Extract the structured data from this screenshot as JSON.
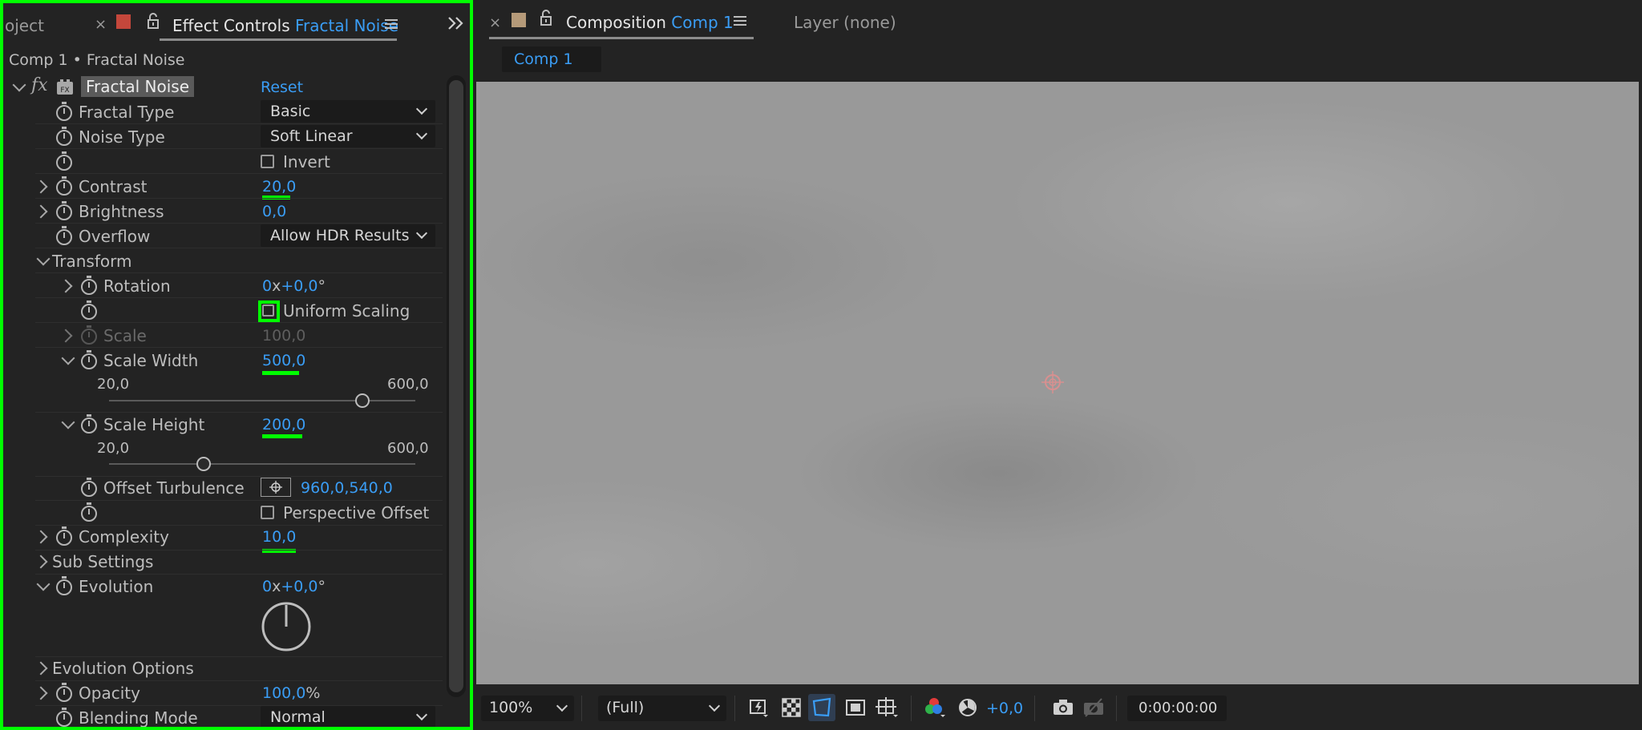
{
  "left_panel": {
    "tabs": {
      "project_partial": "oject",
      "effect_controls_label": "Effect Controls",
      "effect_controls_layer": "Fractal Noise"
    },
    "breadcrumb": "Comp 1 • Fractal Noise",
    "effect": {
      "name": "Fractal Noise",
      "reset_label": "Reset",
      "fx_label": "fx"
    },
    "properties": {
      "fractal_type": {
        "label": "Fractal Type",
        "value": "Basic"
      },
      "noise_type": {
        "label": "Noise Type",
        "value": "Soft Linear"
      },
      "invert": {
        "label": "Invert",
        "checked": false
      },
      "contrast": {
        "label": "Contrast",
        "value": "20,0"
      },
      "brightness": {
        "label": "Brightness",
        "value": "0,0"
      },
      "overflow": {
        "label": "Overflow",
        "value": "Allow HDR Results"
      },
      "transform": {
        "label": "Transform"
      },
      "rotation": {
        "label": "Rotation",
        "rev": "0",
        "sep": "x",
        "deg": "+0,0",
        "unit": "°"
      },
      "uniform_scaling": {
        "label": "Uniform Scaling",
        "checked": false
      },
      "scale": {
        "label": "Scale",
        "value": "100,0"
      },
      "scale_width": {
        "label": "Scale Width",
        "value": "500,0",
        "min": "20,0",
        "max": "600,0",
        "slider_fraction": 0.827
      },
      "scale_height": {
        "label": "Scale Height",
        "value": "200,0",
        "min": "20,0",
        "max": "600,0",
        "slider_fraction": 0.31
      },
      "offset_turbulence": {
        "label": "Offset Turbulence",
        "value": "960,0,540,0"
      },
      "perspective_offset": {
        "label": "Perspective Offset",
        "checked": false
      },
      "complexity": {
        "label": "Complexity",
        "value": "10,0"
      },
      "sub_settings": {
        "label": "Sub Settings"
      },
      "evolution": {
        "label": "Evolution",
        "rev": "0",
        "sep": "x",
        "deg": "+0,0",
        "unit": "°"
      },
      "evolution_options": {
        "label": "Evolution Options"
      },
      "opacity": {
        "label": "Opacity",
        "value": "100,0",
        "unit": "%"
      },
      "blending_mode": {
        "label": "Blending Mode",
        "value": "Normal"
      }
    }
  },
  "right_panel": {
    "tabs": {
      "composition_label": "Composition",
      "composition_name": "Comp 1",
      "layer_label": "Layer (none)"
    },
    "comp_tab": "Comp 1",
    "toolbar": {
      "zoom": "100%",
      "resolution": "(Full)",
      "exposure": "+0,0",
      "timecode": "0:00:00:00"
    }
  },
  "colors": {
    "accent_blue": "#3a9df5",
    "highlight_green": "#00ff00",
    "panel_bg": "#232323",
    "label_color": "#c4473b",
    "comp_color": "#b59a79"
  }
}
